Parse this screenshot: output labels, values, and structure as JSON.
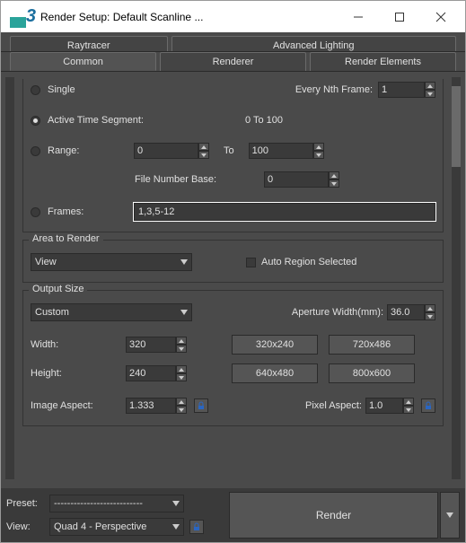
{
  "window": {
    "title": "Render Setup: Default Scanline ..."
  },
  "tabs": {
    "row1": [
      "Raytracer",
      "Advanced Lighting"
    ],
    "row2": [
      "Common",
      "Renderer",
      "Render Elements"
    ],
    "active": "Common"
  },
  "time_output": {
    "single_label": "Single",
    "every_nth_label": "Every Nth Frame:",
    "every_nth_value": "1",
    "active_segment_label": "Active Time Segment:",
    "active_segment_range": "0 To 100",
    "range_label": "Range:",
    "range_from": "0",
    "range_to_label": "To",
    "range_to": "100",
    "file_number_base_label": "File Number Base:",
    "file_number_base": "0",
    "frames_label": "Frames:",
    "frames_value": "1,3,5-12"
  },
  "area_to_render": {
    "title": "Area to Render",
    "mode": "View",
    "auto_region_label": "Auto Region Selected"
  },
  "output_size": {
    "title": "Output Size",
    "preset": "Custom",
    "aperture_label": "Aperture Width(mm):",
    "aperture_value": "36.0",
    "width_label": "Width:",
    "width_value": "320",
    "height_label": "Height:",
    "height_value": "240",
    "presets": [
      "320x240",
      "720x486",
      "640x480",
      "800x600"
    ],
    "image_aspect_label": "Image Aspect:",
    "image_aspect_value": "1.333",
    "pixel_aspect_label": "Pixel Aspect:",
    "pixel_aspect_value": "1.0"
  },
  "bottom": {
    "preset_label": "Preset:",
    "preset_value": "---------------------------",
    "view_label": "View:",
    "view_value": "Quad 4 - Perspective",
    "render_label": "Render"
  }
}
